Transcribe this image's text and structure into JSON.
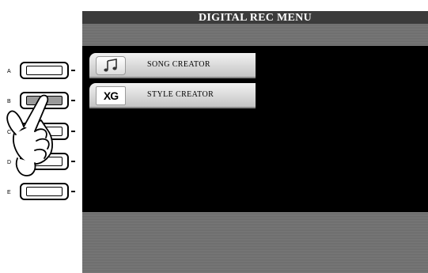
{
  "screen": {
    "title": "DIGITAL REC MENU"
  },
  "menu": {
    "items": [
      {
        "label": "SONG CREATOR",
        "icon": "music-note-icon"
      },
      {
        "label": "STYLE CREATOR",
        "icon": "xg-logo-icon",
        "icon_text": "XG"
      }
    ]
  },
  "panel_buttons": [
    "A",
    "B",
    "C",
    "D",
    "E"
  ],
  "pressed_button": "B",
  "colors": {
    "lcd_background": "#000000",
    "title_bar": "#3b3b3b",
    "menu_tab": "#d9d9d9"
  }
}
